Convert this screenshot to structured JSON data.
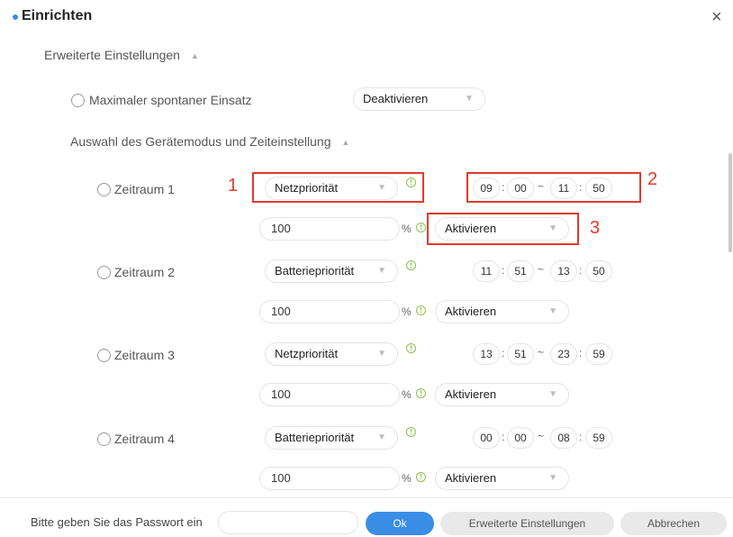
{
  "dialog": {
    "title": "Einrichten",
    "close_icon": "×"
  },
  "advanced": {
    "title": "Erweiterte Einstellungen",
    "max_feed": {
      "label": "Maximaler spontaner Einsatz",
      "value": "Deaktivieren"
    },
    "mode_title": "Auswahl des Gerätemodus und Zeiteinstellung"
  },
  "periods": [
    {
      "label": "Zeitraum 1",
      "mode": "Netzpriorität",
      "start_h": "09",
      "start_m": "00",
      "end_h": "11",
      "end_m": "50",
      "percent": "100",
      "enable": "Aktivieren"
    },
    {
      "label": "Zeitraum 2",
      "mode": "Batteriepriorität",
      "start_h": "11",
      "start_m": "51",
      "end_h": "13",
      "end_m": "50",
      "percent": "100",
      "enable": "Aktivieren"
    },
    {
      "label": "Zeitraum 3",
      "mode": "Netzpriorität",
      "start_h": "13",
      "start_m": "51",
      "end_h": "23",
      "end_m": "59",
      "percent": "100",
      "enable": "Aktivieren"
    },
    {
      "label": "Zeitraum 4",
      "mode": "Batteriepriorität",
      "start_h": "00",
      "start_m": "00",
      "end_h": "08",
      "end_m": "59",
      "percent": "100",
      "enable": "Aktivieren"
    }
  ],
  "symbols": {
    "percent": "%",
    "colon": ":",
    "tilde": "~",
    "info": "!",
    "caret_up": "▲",
    "caret_down": "▼"
  },
  "annotations": {
    "n1": "1",
    "n2": "2",
    "n3": "3",
    "color": "#e23a2f"
  },
  "footer": {
    "password_label": "Bitte geben Sie das Passwort ein",
    "password_placeholder": "",
    "ok": "Ok",
    "advanced": "Erweiterte Einstellungen",
    "cancel": "Abbrechen"
  },
  "colors": {
    "accent": "#3a8ee6",
    "info": "#8bc34a"
  }
}
